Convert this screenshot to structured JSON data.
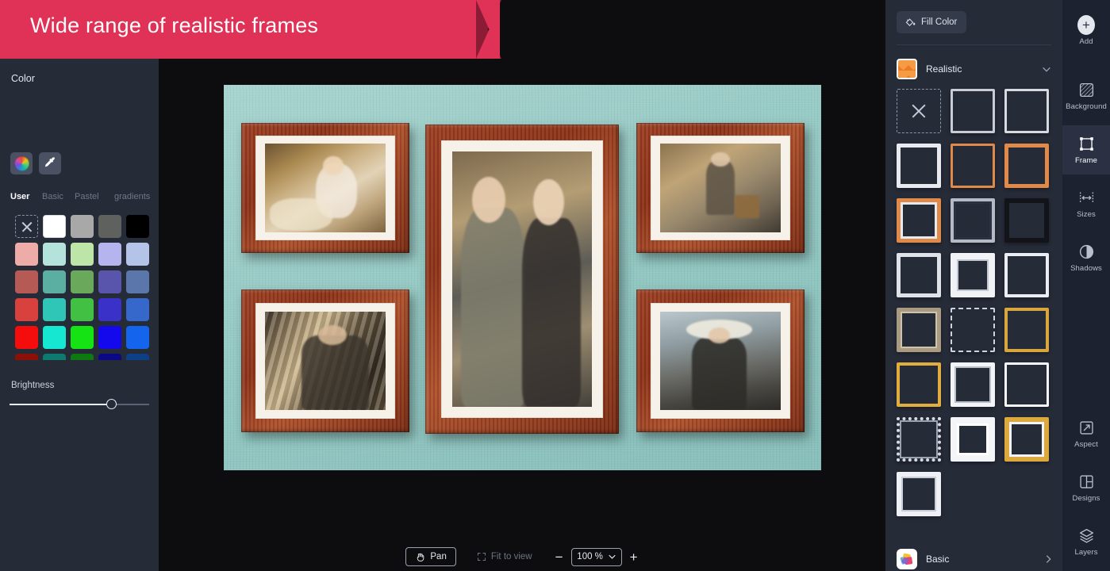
{
  "banner": {
    "text": "Wide range of realistic frames",
    "color": "#e03156"
  },
  "left_panel": {
    "title": "Color",
    "tools": [
      {
        "name": "color-wheel-icon",
        "label": "Color wheel"
      },
      {
        "name": "eyedropper-icon",
        "label": "Eyedropper"
      }
    ],
    "tabs": [
      {
        "label": "User",
        "active": true
      },
      {
        "label": "Basic",
        "active": false
      },
      {
        "label": "Pastel",
        "active": false
      },
      {
        "label": "gradients",
        "active": false
      }
    ],
    "swatches": [
      "none",
      "#ffffff",
      "#a8a8a8",
      "#5f615e",
      "#000000",
      "#eeaca8",
      "#b3e3da",
      "#bde5a8",
      "#b5b4ef",
      "#b4c4e8",
      "#b65a56",
      "#5aaea2",
      "#6aa85c",
      "#5a55ac",
      "#5b76ab",
      "#d8413e",
      "#2fc5b7",
      "#41c044",
      "#3a31c9",
      "#3667ca",
      "#f40d0c",
      "#16e7d0",
      "#15e313",
      "#1409ec",
      "#1564ee",
      "#8c1008",
      "#0d7a70",
      "#0d7a11",
      "#0b0887",
      "#0d4087"
    ],
    "brightness": {
      "label": "Brightness",
      "value": 73
    }
  },
  "canvas": {
    "artboard_bg": "#9ecfca",
    "photos": [
      {
        "name": "photo-woman-blonde",
        "style": "ph-a"
      },
      {
        "name": "photo-couple-formal",
        "style": "ph-b"
      },
      {
        "name": "photo-boy-suitcase",
        "style": "ph-c"
      },
      {
        "name": "photo-man-blinds",
        "style": "ph-d"
      },
      {
        "name": "photo-woman-hat",
        "style": "ph-e"
      }
    ]
  },
  "bottom_bar": {
    "pan_label": "Pan",
    "fit_label": "Fit to view",
    "zoom_minus": "−",
    "zoom_value": "100 %",
    "zoom_plus": "+"
  },
  "right_panel": {
    "fill_color_label": "Fill Color",
    "category_realistic": "Realistic",
    "category_basic": "Basic",
    "frames": [
      {
        "name": "frame-none",
        "type": "none"
      },
      {
        "name": "frame-thin-white",
        "border": "3px solid #c9ccd4",
        "inner": ""
      },
      {
        "name": "frame-thin-white-2",
        "border": "3px solid #d6d9e0",
        "inner": ""
      },
      {
        "name": "frame-white-medium",
        "border": "5px solid #e8eaef",
        "inner": ""
      },
      {
        "name": "frame-orange-thin",
        "border": "3px solid #e08a4a",
        "inner": ""
      },
      {
        "name": "frame-orange-medium",
        "border": "5px solid #e08a4a",
        "inner": ""
      },
      {
        "name": "frame-orange-white-combo",
        "border": "5px solid #e08a4a",
        "inner": "inset 0 0 0 3px #e6e9ef"
      },
      {
        "name": "frame-grey-double",
        "border": "4px solid #b6bac4",
        "inner": "inset 0 0 0 3px #2b3142"
      },
      {
        "name": "frame-black-bevel",
        "border": "6px solid #121419",
        "inner": ""
      },
      {
        "name": "frame-white-slab",
        "border": "5px solid #dfe2e9",
        "inner": ""
      },
      {
        "name": "frame-white-thick",
        "border": "8px solid #f0f2f6",
        "inner": "inset 0 0 0 2px #c4c8d2"
      },
      {
        "name": "frame-white-slim",
        "border": "4px solid #eaedf3",
        "inner": ""
      },
      {
        "name": "frame-tan-woven",
        "border": "5px solid #a89b82",
        "inner": "inset 0 0 0 2px #cfc4ab"
      },
      {
        "name": "frame-dashed-corners",
        "border": "2px dashed #cfd3dc",
        "inner": ""
      },
      {
        "name": "frame-gold-thin",
        "border": "4px solid #d8a63c",
        "inner": ""
      },
      {
        "name": "frame-gold-medium",
        "border": "4px solid #e0ad3e",
        "inner": ""
      },
      {
        "name": "frame-white-box",
        "border": "5px solid #f2f4f8",
        "inner": "inset 0 0 0 2px #b9bec9"
      },
      {
        "name": "frame-white-outline",
        "border": "3px solid #f4f6fa",
        "inner": ""
      },
      {
        "name": "frame-stamp-edge",
        "border": "4px dotted #d8dbe2",
        "inner": "inset 0 0 0 2px #9aa1b0"
      },
      {
        "name": "frame-white-mat-thick",
        "border": "8px solid #f3f5f9",
        "inner": "inset 0 0 0 3px #ffffff"
      },
      {
        "name": "frame-gold-bevel",
        "border": "6px solid #dca93f",
        "inner": "inset 0 0 0 3px #f2f4f8"
      },
      {
        "name": "frame-white-final",
        "border": "6px solid #eef0f5",
        "inner": "inset 0 0 0 2px #c9cdd7"
      }
    ]
  },
  "toolbar": {
    "items": [
      {
        "label": "Add",
        "icon": "plus-icon",
        "active": false
      },
      {
        "label": "Background",
        "icon": "hatch-square-icon",
        "active": false
      },
      {
        "label": "Frame",
        "icon": "frame-corners-icon",
        "active": true
      },
      {
        "label": "Sizes",
        "icon": "horizontal-arrow-icon",
        "active": false
      },
      {
        "label": "Shadows",
        "icon": "half-circle-icon",
        "active": false
      },
      {
        "label": "Aspect",
        "icon": "diagonal-arrow-icon",
        "active": false
      },
      {
        "label": "Designs",
        "icon": "grid-panel-icon",
        "active": false
      },
      {
        "label": "Layers",
        "icon": "layers-stack-icon",
        "active": false
      }
    ]
  }
}
